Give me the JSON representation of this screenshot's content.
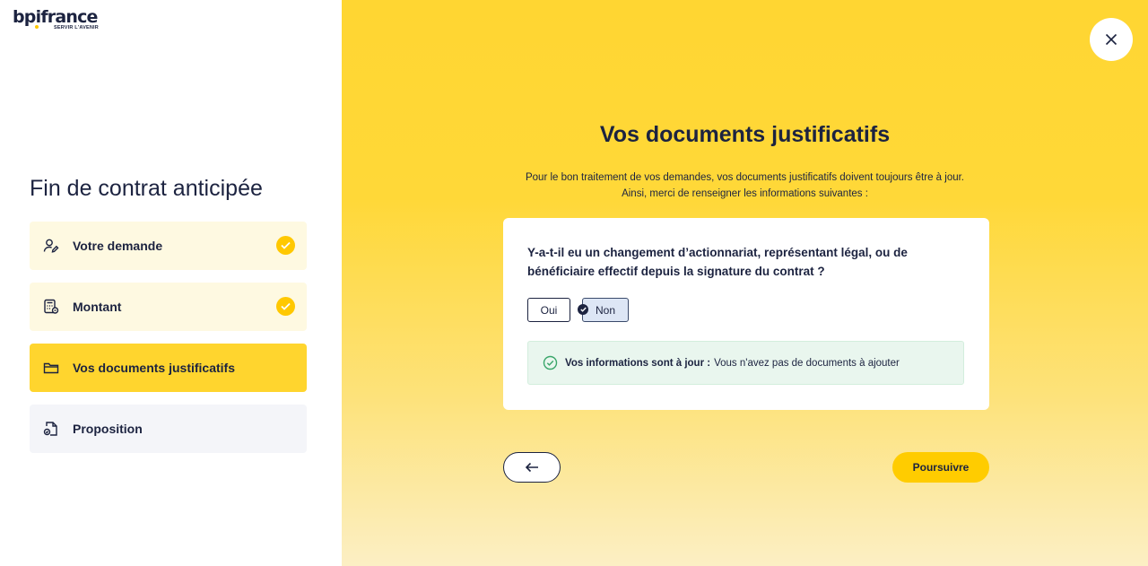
{
  "brand": {
    "name": "bpifrance",
    "tagline": "SERVIR L'AVENIR",
    "accent": "#ffc800"
  },
  "sidebar": {
    "title": "Fin de contrat anticipée",
    "steps": [
      {
        "label": "Votre demande",
        "state": "done",
        "icon": "user-edit-icon"
      },
      {
        "label": "Montant",
        "state": "done",
        "icon": "calculator-icon"
      },
      {
        "label": "Vos documents justificatifs",
        "state": "active",
        "icon": "folder-icon"
      },
      {
        "label": "Proposition",
        "state": "todo",
        "icon": "document-signature-icon"
      }
    ]
  },
  "main": {
    "title": "Vos documents justificatifs",
    "intro_line1": "Pour le bon traitement de vos demandes, vos documents justificatifs doivent toujours être à jour.",
    "intro_line2": "Ainsi, merci de renseigner les informations suivantes :",
    "question": "Y-a-t-il eu un changement d’actionnariat, représentant légal, ou de bénéficiaire effectif depuis la signature du contrat ?",
    "options": [
      {
        "label": "Oui",
        "selected": false
      },
      {
        "label": "Non",
        "selected": true
      }
    ],
    "info_strong": "Vos informations sont à jour :",
    "info_text": "Vous n'avez pas de documents à ajouter",
    "next_label": "Poursuivre"
  }
}
